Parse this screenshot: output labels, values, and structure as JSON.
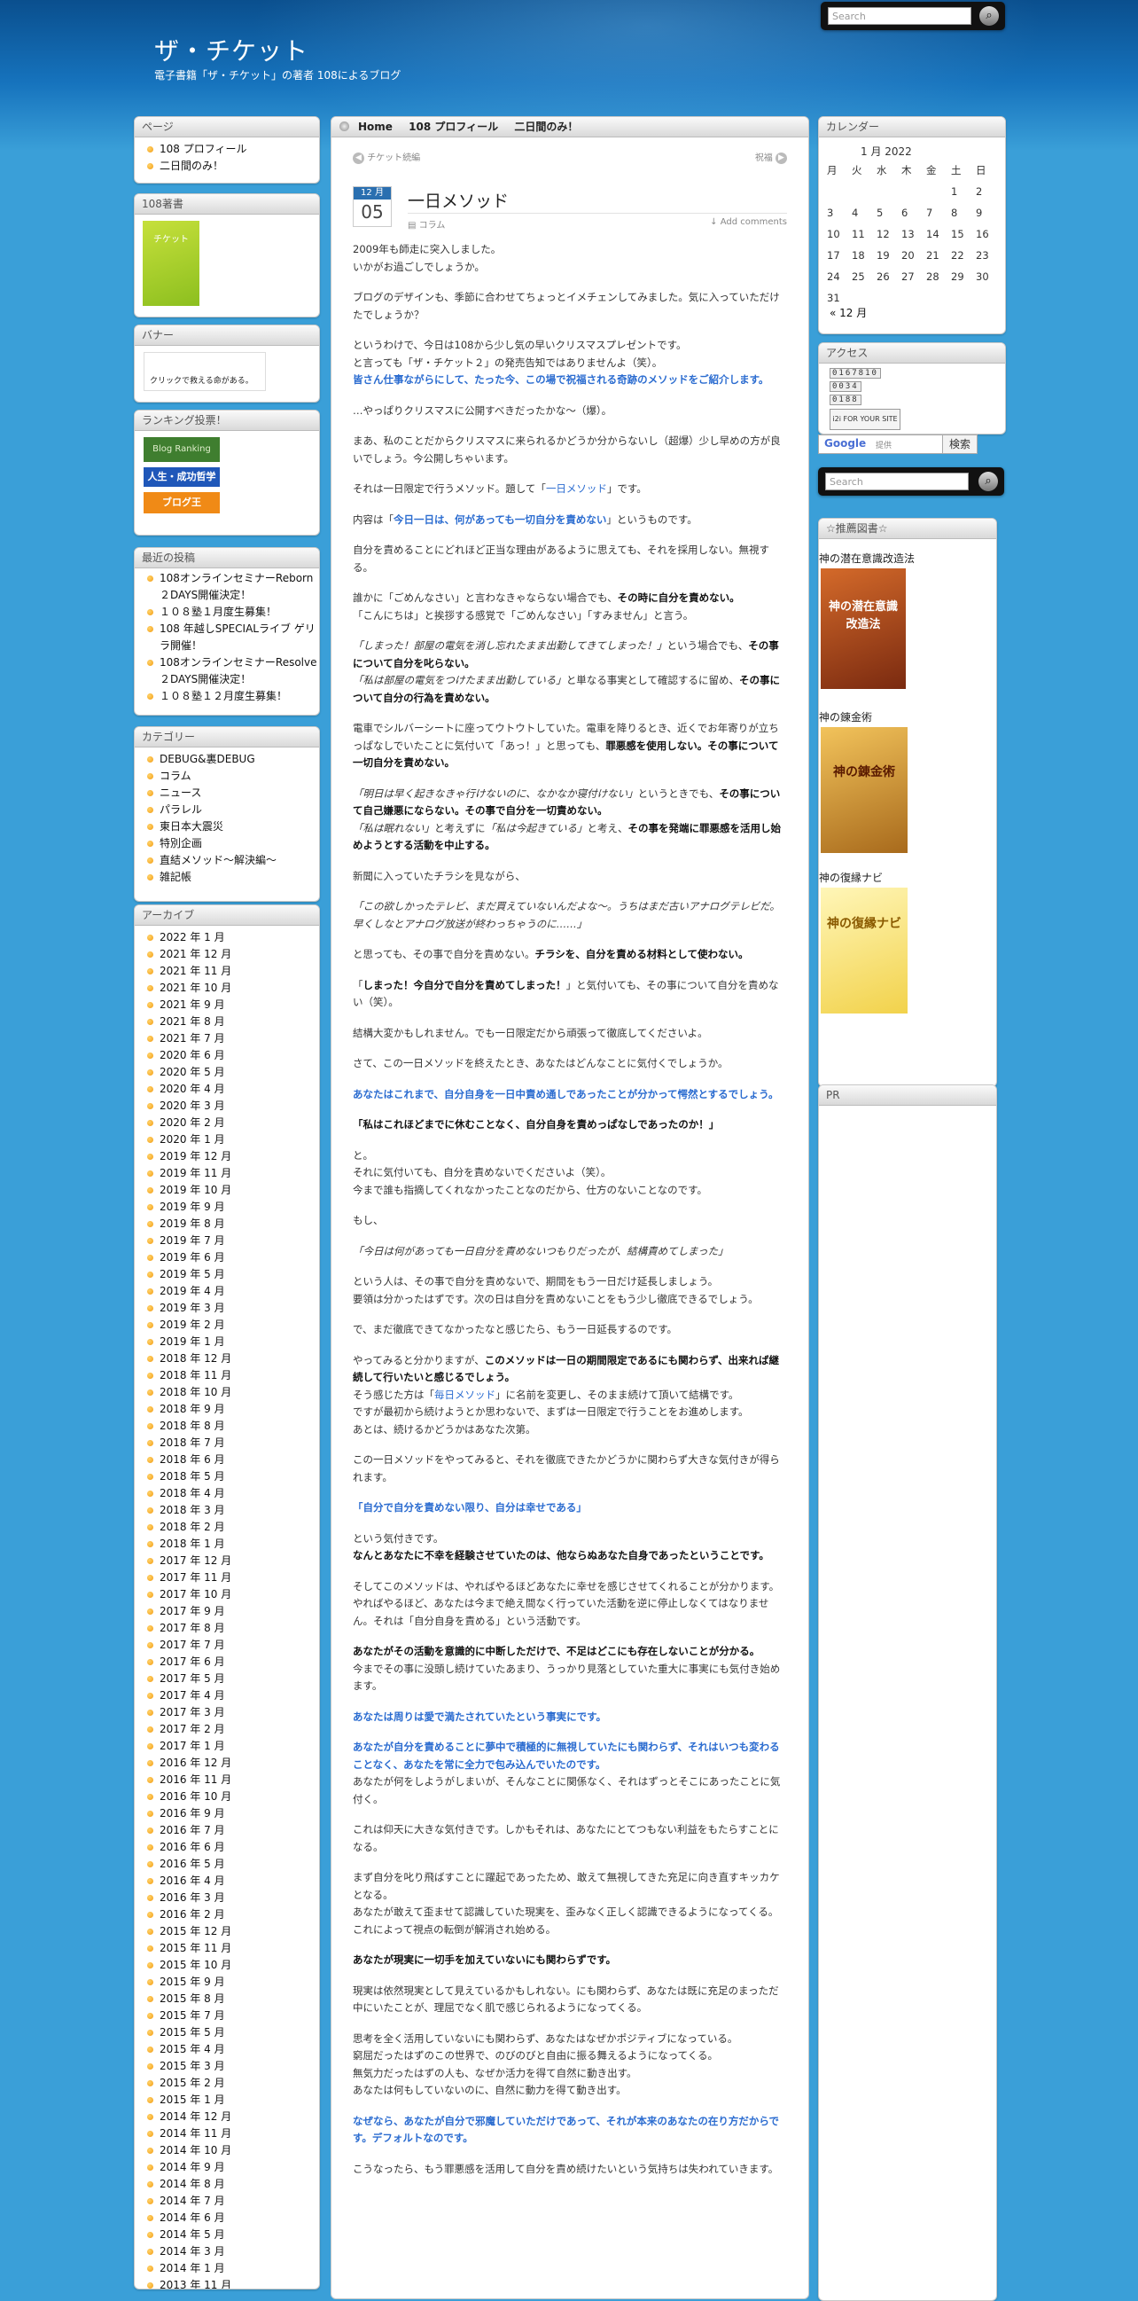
{
  "header": {
    "title": "ザ・チケット",
    "description": "電子書籍「ザ・チケット」の著者 108によるブログ"
  },
  "search": {
    "placeholder": "Search",
    "icon": "magnifier-icon"
  },
  "sidebar_left": {
    "pages": {
      "title": "ページ",
      "items": [
        "108 プロフィール",
        "二日間のみ！"
      ]
    },
    "book": {
      "title": "108著書",
      "cover_text": "チケット"
    },
    "banner": {
      "title": "バナー",
      "text": "クリックで救える命がある。"
    },
    "ranking": {
      "title": "ランキング投票！",
      "items": [
        "Blog Ranking",
        "人生・成功哲学",
        "ブログ王"
      ]
    },
    "recent": {
      "title": "最近の投稿",
      "items": [
        "108オンラインセミナーReborn２DAYS開催決定！",
        "１０８塾１月度生募集！",
        "108 年越しSPECIALライブ ゲリラ開催！",
        "108オンラインセミナーResolve ２DAYS開催決定！",
        "１０８塾１２月度生募集！"
      ]
    },
    "categories": {
      "title": "カテゴリー",
      "items": [
        "DEBUG&裏DEBUG",
        "コラム",
        "ニュース",
        "パラレル",
        "東日本大震災",
        "特別企画",
        "直結メソッド〜解決編〜",
        "雑記帳"
      ]
    },
    "archive": {
      "title": "アーカイブ",
      "items": [
        "2022 年 1 月",
        "2021 年 12 月",
        "2021 年 11 月",
        "2021 年 10 月",
        "2021 年 9 月",
        "2021 年 8 月",
        "2021 年 7 月",
        "2020 年 6 月",
        "2020 年 5 月",
        "2020 年 4 月",
        "2020 年 3 月",
        "2020 年 2 月",
        "2020 年 1 月",
        "2019 年 12 月",
        "2019 年 11 月",
        "2019 年 10 月",
        "2019 年 9 月",
        "2019 年 8 月",
        "2019 年 7 月",
        "2019 年 6 月",
        "2019 年 5 月",
        "2019 年 4 月",
        "2019 年 3 月",
        "2019 年 2 月",
        "2019 年 1 月",
        "2018 年 12 月",
        "2018 年 11 月",
        "2018 年 10 月",
        "2018 年 9 月",
        "2018 年 8 月",
        "2018 年 7 月",
        "2018 年 6 月",
        "2018 年 5 月",
        "2018 年 4 月",
        "2018 年 3 月",
        "2018 年 2 月",
        "2018 年 1 月",
        "2017 年 12 月",
        "2017 年 11 月",
        "2017 年 10 月",
        "2017 年 9 月",
        "2017 年 8 月",
        "2017 年 7 月",
        "2017 年 6 月",
        "2017 年 5 月",
        "2017 年 4 月",
        "2017 年 3 月",
        "2017 年 2 月",
        "2017 年 1 月",
        "2016 年 12 月",
        "2016 年 11 月",
        "2016 年 10 月",
        "2016 年 9 月",
        "2016 年 7 月",
        "2016 年 6 月",
        "2016 年 5 月",
        "2016 年 4 月",
        "2016 年 3 月",
        "2016 年 2 月",
        "2015 年 12 月",
        "2015 年 11 月",
        "2015 年 10 月",
        "2015 年 9 月",
        "2015 年 8 月",
        "2015 年 7 月",
        "2015 年 5 月",
        "2015 年 4 月",
        "2015 年 3 月",
        "2015 年 2 月",
        "2015 年 1 月",
        "2014 年 12 月",
        "2014 年 11 月",
        "2014 年 10 月",
        "2014 年 9 月",
        "2014 年 8 月",
        "2014 年 7 月",
        "2014 年 6 月",
        "2014 年 5 月",
        "2014 年 3 月",
        "2014 年 1 月",
        "2013 年 11 月"
      ]
    }
  },
  "main": {
    "nav": [
      "Home",
      "108 プロフィール",
      "二日間のみ！"
    ],
    "prev_post": "チケット続編",
    "next_post": "祝福",
    "date": {
      "month": "12 月",
      "day": "05"
    },
    "title": "一日メソッド",
    "category": "コラム",
    "comments": "Add comments"
  },
  "sidebar_right": {
    "calendar": {
      "title": "カレンダー",
      "caption": "1 月 2022",
      "headers": [
        "月",
        "火",
        "水",
        "木",
        "金",
        "土",
        "日"
      ],
      "rows": [
        [
          "",
          "",
          "",
          "",
          "",
          "1",
          "2"
        ],
        [
          "3",
          "4",
          "5",
          "6",
          "7",
          "8",
          "9"
        ],
        [
          "10",
          "11",
          "12",
          "13",
          "14",
          "15",
          "16"
        ],
        [
          "17",
          "18",
          "19",
          "20",
          "21",
          "22",
          "23"
        ],
        [
          "24",
          "25",
          "26",
          "27",
          "28",
          "29",
          "30"
        ],
        [
          "31",
          "",
          "",
          "",
          "",
          "",
          ""
        ]
      ],
      "prev_link": "« 12 月"
    },
    "access": {
      "title": "アクセス",
      "counters": [
        "0167810",
        "0034",
        "0188"
      ],
      "i2i": "i2i FOR YOUR SITE"
    },
    "google": {
      "brand": "Google",
      "hint": "提供",
      "button": "検索"
    },
    "books": {
      "title": "☆推薦図書☆",
      "items": [
        {
          "name": "神の潜在意識改造法",
          "cover": "神の潜在意識改造法"
        },
        {
          "name": "神の錬金術",
          "cover": "神の錬金術"
        },
        {
          "name": "神の復縁ナビ",
          "cover": "神の復縁ナビ"
        }
      ]
    },
    "pr": {
      "title": "PR"
    }
  },
  "colors": {
    "background": "#3a9fd8",
    "header_dark": "#0a4f8e",
    "link_blue": "#2b6cd0",
    "bullet": "#f39c12"
  }
}
